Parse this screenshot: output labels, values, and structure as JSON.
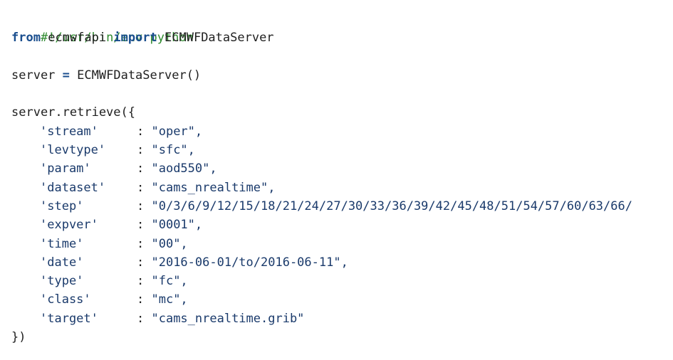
{
  "code": {
    "shebang": "#!/usr/bin/env python",
    "import_from": "from",
    "module": "ecmwfapi",
    "import_kw": "import",
    "imported_name": "ECMWFDataServer",
    "server_var": "server",
    "assign_op": "=",
    "server_ctor": "ECMWFDataServer()",
    "retrieve_call": "server.retrieve({",
    "params": [
      {
        "key": "'stream'",
        "value": "\"oper\","
      },
      {
        "key": "'levtype'",
        "value": "\"sfc\","
      },
      {
        "key": "'param'",
        "value": "\"aod550\","
      },
      {
        "key": "'dataset'",
        "value": "\"cams_nrealtime\","
      },
      {
        "key": "'step'",
        "value": "\"0/3/6/9/12/15/18/21/24/27/30/33/36/39/42/45/48/51/54/57/60/63/66/"
      },
      {
        "key": "'expver'",
        "value": "\"0001\","
      },
      {
        "key": "'time'",
        "value": "\"00\","
      },
      {
        "key": "'date'",
        "value": "\"2016-06-01/to/2016-06-11\","
      },
      {
        "key": "'type'",
        "value": "\"fc\","
      },
      {
        "key": "'class'",
        "value": "\"mc\","
      },
      {
        "key": "'target'",
        "value": "\"cams_nrealtime.grib\""
      }
    ],
    "separator": ": ",
    "closing": "})"
  },
  "colors": {
    "comment": "#2f8a2f",
    "keyword": "#1a4e8e",
    "string": "#1a3a6b",
    "text": "#1f1f1f",
    "background": "#ffffff"
  }
}
